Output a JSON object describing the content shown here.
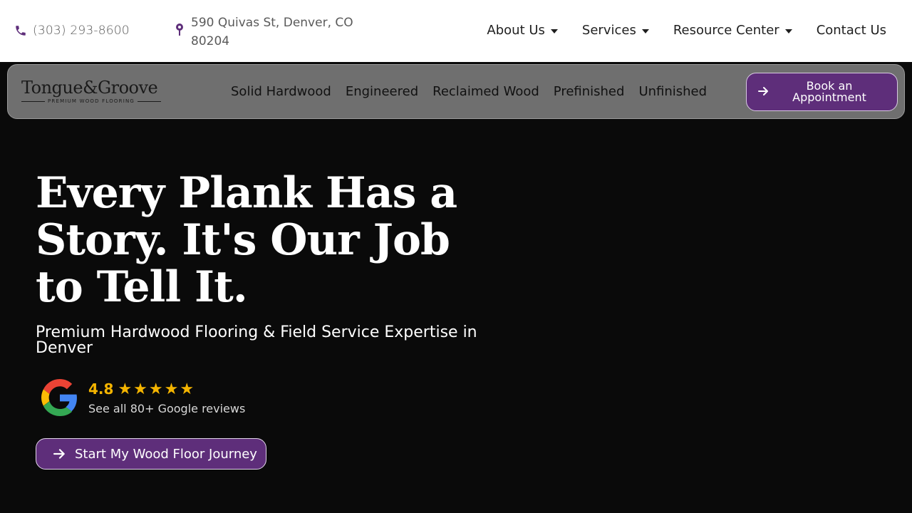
{
  "topbar": {
    "phone": "(303) 293-8600",
    "address_line1": "590 Quivas St, Denver, CO",
    "address_line2": "80204",
    "nav": [
      {
        "label": "About Us",
        "dropdown": true
      },
      {
        "label": "Services",
        "dropdown": true
      },
      {
        "label": "Resource Center",
        "dropdown": true
      },
      {
        "label": "Contact Us",
        "dropdown": false
      }
    ]
  },
  "navbar": {
    "logo_text": "Tongue&Groove",
    "logo_tagline": "PREMIUM WOOD FLOORING",
    "links": [
      "Solid Hardwood",
      "Engineered",
      "Reclaimed Wood",
      "Prefinished",
      "Unfinished"
    ],
    "book_button": "Book an Appointment"
  },
  "hero": {
    "title": "Every Plank Has a Story. It's Our Job to Tell It.",
    "subtitle": "Premium Hardwood Flooring & Field Service Expertise in Denver",
    "rating": {
      "score": "4.8",
      "stars": "★★★★★",
      "reviews_text": "See all 80+ Google reviews"
    },
    "cta": "Start My Wood Floor Journey"
  },
  "icons": {
    "phone": "phone-icon",
    "location": "map-pin-icon",
    "google": "google-logo-icon",
    "arrow": "arrow-right-icon"
  },
  "colors": {
    "brand_purple": "#5e2e7a",
    "star_gold": "#f4b400",
    "hero_bg": "#0a0a0a",
    "navbar_bg": "#6f6f6f"
  }
}
